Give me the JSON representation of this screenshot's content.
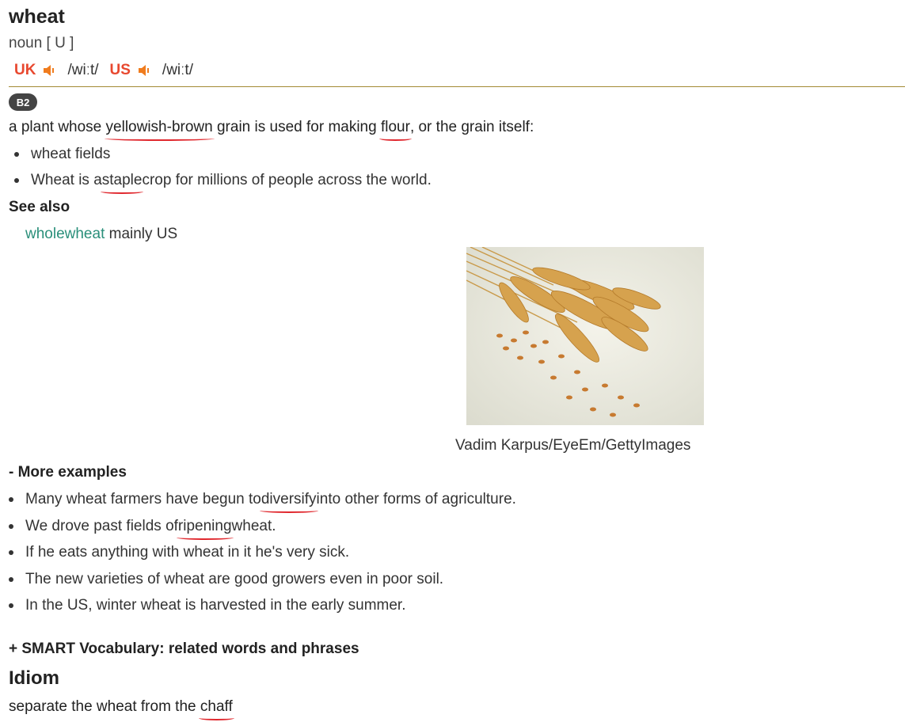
{
  "entry": {
    "headword": "wheat",
    "pos": "noun [ U ]",
    "uk_label": "UK",
    "uk_ipa": "/wiːt/",
    "us_label": "US",
    "us_ipa": "/wiːt/",
    "level": "B2"
  },
  "definition": {
    "p1": "a plant whose ",
    "w1": "yellowish-brown",
    "p2": " grain is used for making ",
    "w2": "flour",
    "p3": ", or the grain itself:"
  },
  "examples": {
    "e1": "wheat fields",
    "e2_a": "Wheat is a ",
    "e2_w": "staple",
    "e2_b": " crop for millions of people across the world."
  },
  "see_also": {
    "heading": "See also",
    "link": "wholewheat",
    "note": " mainly US"
  },
  "image": {
    "icon": "wheat-photo",
    "caption": "Vadim Karpus/EyeEm/GettyImages"
  },
  "more_examples": {
    "heading": "- More examples",
    "m1_a": "Many wheat farmers have begun to ",
    "m1_w": "diversify",
    "m1_b": " into other forms of agriculture.",
    "m2_a": "We drove past fields of ",
    "m2_w": "ripening",
    "m2_b": " wheat.",
    "m3": "If he eats anything with wheat in it he's very sick.",
    "m4": "The new varieties of wheat are good growers even in poor soil.",
    "m5": "In the US, winter wheat is harvested in the early summer."
  },
  "smart_vocab": "+ SMART Vocabulary: related words and phrases",
  "idiom": {
    "heading": "Idiom",
    "text_a": "separate the wheat from the ",
    "text_w": "chaff"
  },
  "colors": {
    "region": "#e8482f",
    "link": "#2a8f7a",
    "spellcheck_underline": "#e0282e",
    "rule": "#a38a34"
  }
}
